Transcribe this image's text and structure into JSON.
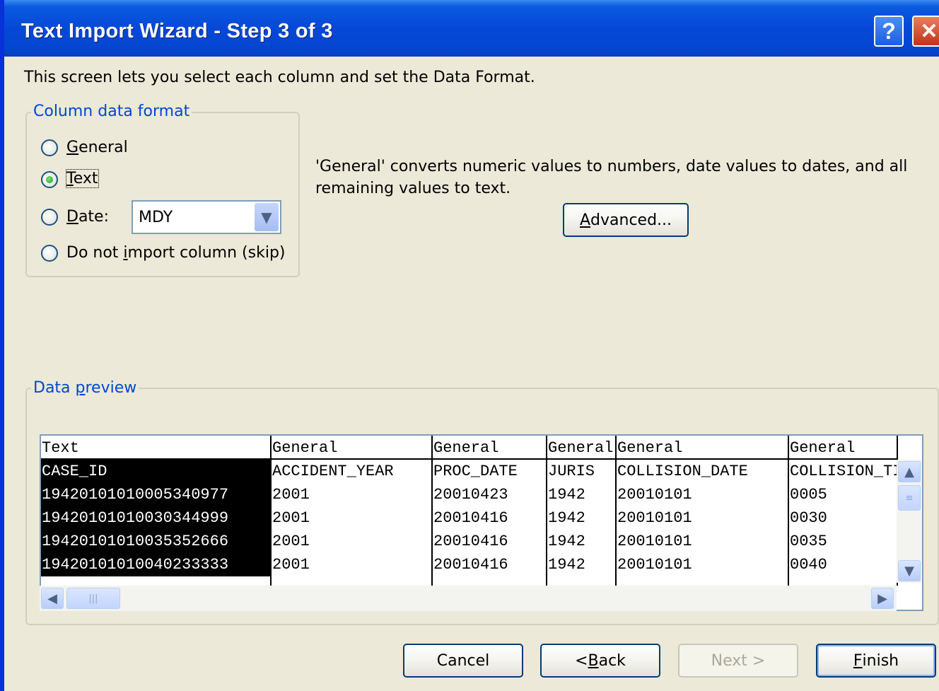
{
  "window": {
    "title": "Text Import Wizard - Step 3 of 3",
    "help_glyph": "?",
    "close_glyph": "✕"
  },
  "intro_text": "This screen lets you select each column and set the Data Format.",
  "column_format": {
    "legend": "Column data format",
    "options": [
      {
        "label": "General",
        "accel": "G",
        "rest": "eneral",
        "selected": false
      },
      {
        "label": "Text",
        "accel": "T",
        "rest": "ext",
        "selected": true
      },
      {
        "label": "Date:",
        "accel": "D",
        "rest": "ate:",
        "selected": false
      },
      {
        "label": "Do not import column (skip)",
        "pre": "Do not ",
        "accel": "i",
        "rest": "mport column (skip)",
        "selected": false
      }
    ],
    "date_format": "MDY"
  },
  "description": "'General' converts numeric values to numbers, date values to dates, and all remaining values to text.",
  "advanced_button": {
    "label": "Advanced...",
    "accel": "A",
    "rest": "dvanced..."
  },
  "preview": {
    "legend": "Data preview",
    "legend_pre": "Data ",
    "legend_accel": "p",
    "legend_rest": "review",
    "columns": [
      {
        "format": "Text",
        "selected": true,
        "cells": [
          "CASE_ID",
          "19420101010005340977",
          "19420101010030344999",
          "19420101010035352666",
          "19420101010040233333"
        ]
      },
      {
        "format": "General",
        "selected": false,
        "cells": [
          "ACCIDENT_YEAR",
          "2001",
          "2001",
          "2001",
          "2001"
        ]
      },
      {
        "format": "General",
        "selected": false,
        "cells": [
          "PROC_DATE",
          "20010423",
          "20010416",
          "20010416",
          "20010416"
        ]
      },
      {
        "format": "General",
        "selected": false,
        "cells": [
          "JURIS",
          "1942",
          "1942",
          "1942",
          "1942"
        ]
      },
      {
        "format": "General",
        "selected": false,
        "cells": [
          "COLLISION_DATE",
          "20010101",
          "20010101",
          "20010101",
          "20010101"
        ]
      },
      {
        "format": "General",
        "selected": false,
        "cells": [
          "COLLISION_TIME",
          "0005",
          "0030",
          "0035",
          "0040"
        ]
      }
    ]
  },
  "buttons": {
    "cancel": "Cancel",
    "back": {
      "label": "< Back",
      "pre": "< ",
      "accel": "B",
      "rest": "ack"
    },
    "next": "Next >",
    "finish": {
      "label": "Finish",
      "accel": "F",
      "rest": "inish"
    }
  },
  "colors": {
    "title_bar": "#0548d8",
    "accent_legend": "#0046d5",
    "window_bg": "#ece9d8"
  }
}
